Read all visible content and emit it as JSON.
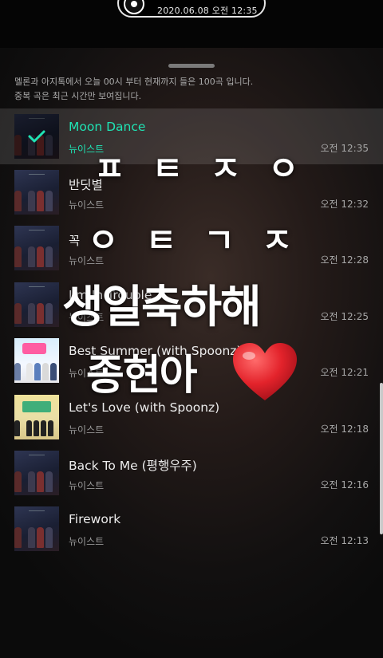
{
  "status": {
    "date": "2020.06.08",
    "ampm": "오전",
    "time": "12:35"
  },
  "notice": {
    "line1": "멜론과 아지톡에서 오늘 00시 부터 현재까지 들은 100곡 입니다.",
    "line2": "중복 곡은 최근 시간만 보여집니다."
  },
  "tracks": [
    {
      "title": "Moon Dance",
      "artist": "뉴이스트",
      "time": "오전 12:35",
      "playing": true,
      "art": "dark"
    },
    {
      "title": "반딧별",
      "artist": "뉴이스트",
      "time": "오전 12:32",
      "art": "dark"
    },
    {
      "title": "꼭",
      "artist": "뉴이스트",
      "time": "오전 12:28",
      "art": "dark"
    },
    {
      "title": "I'm In Trouble",
      "artist": "뉴이스트",
      "time": "오전 12:25",
      "art": "dark"
    },
    {
      "title": "Best Summer (with Spoonz)",
      "artist": "뉴이스트",
      "time": "오전 12:21",
      "art": "light"
    },
    {
      "title": "Let's Love (with Spoonz)",
      "artist": "뉴이스트",
      "time": "오전 12:18",
      "art": "yellow"
    },
    {
      "title": "Back To Me (평행우주)",
      "artist": "뉴이스트",
      "time": "오전 12:16",
      "art": "dark"
    },
    {
      "title": "Firework",
      "artist": "뉴이스트",
      "time": "오전 12:13",
      "art": "dark"
    }
  ],
  "overlay": {
    "line1": "ㅍㅌㅈㅇ",
    "line2": "ㅇㅌㄱㅈ",
    "line3": "생일축하해",
    "line4": "종현아"
  },
  "colors": {
    "accent": "#1fe3b4",
    "heart": "#e3232b"
  }
}
